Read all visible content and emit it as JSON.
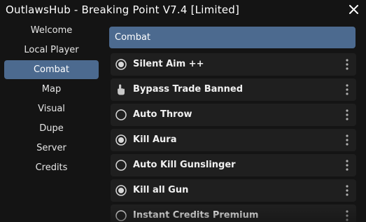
{
  "window": {
    "title": "OutlawsHub - Breaking Point V7.4 [Limited]"
  },
  "colors": {
    "accent": "#4c6a8f",
    "background": "#141414",
    "row_background": "#1f1f1f",
    "text": "#f0f0f0"
  },
  "sidebar": {
    "items": [
      {
        "label": "Welcome",
        "active": false
      },
      {
        "label": "Local Player",
        "active": false
      },
      {
        "label": "Combat",
        "active": true
      },
      {
        "label": "Map",
        "active": false
      },
      {
        "label": "Visual",
        "active": false
      },
      {
        "label": "Dupe",
        "active": false
      },
      {
        "label": "Server",
        "active": false
      },
      {
        "label": "Credits",
        "active": false
      }
    ]
  },
  "main": {
    "section_title": "Combat",
    "options": [
      {
        "label": "Silent Aim ++",
        "icon": "radio-checked-icon",
        "enabled": true
      },
      {
        "label": "Bypass Trade Banned",
        "icon": "hand-pointer-icon",
        "enabled": false
      },
      {
        "label": "Auto Throw",
        "icon": "radio-empty-icon",
        "enabled": false
      },
      {
        "label": "Kill Aura",
        "icon": "radio-checked-icon",
        "enabled": true
      },
      {
        "label": "Auto Kill Gunslinger",
        "icon": "radio-empty-icon",
        "enabled": false
      },
      {
        "label": "Kill all Gun",
        "icon": "radio-checked-icon",
        "enabled": true
      },
      {
        "label": "Instant Credits Premium",
        "icon": "radio-empty-icon",
        "enabled": false
      }
    ]
  }
}
